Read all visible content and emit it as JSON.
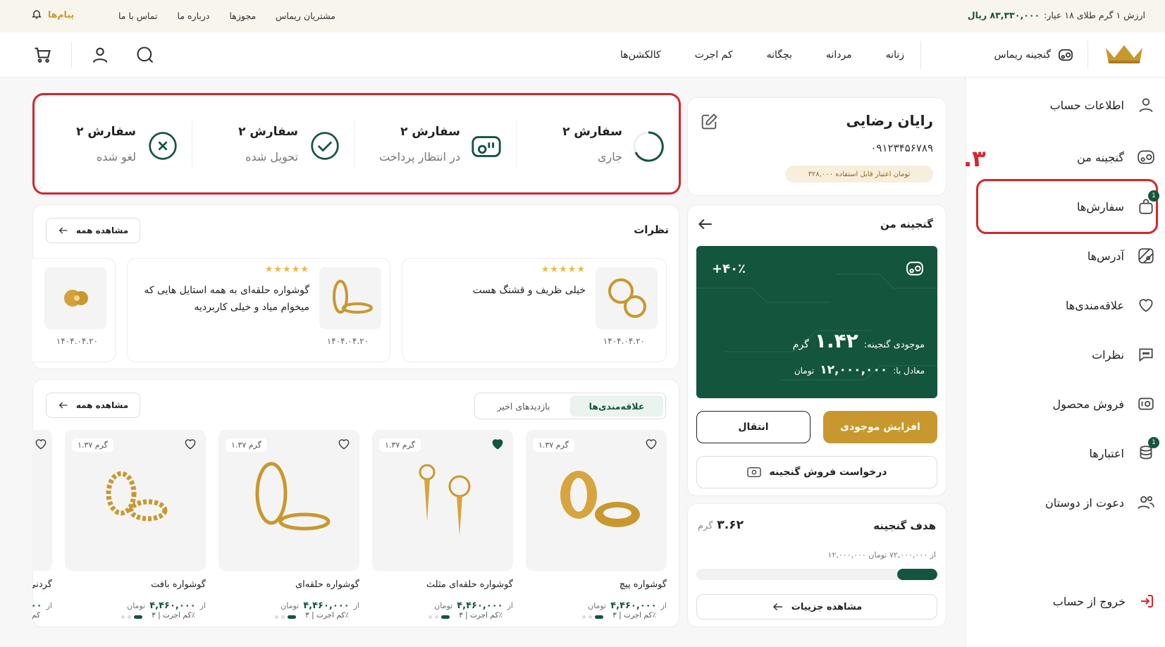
{
  "topbar": {
    "gold_price_label": "ارزش ۱ گرم طلای ۱۸ عیار:",
    "gold_price_value": "۸۳,۳۳۰,۰۰۰ ریال",
    "messages": "پیام‌ها",
    "links": [
      "تماس با ما",
      "درباره ما",
      "مجوزها",
      "مشتریان ریماس"
    ]
  },
  "nav": {
    "items": [
      "گنجینه ریماس",
      "زنانه",
      "مردانه",
      "بچگانه",
      "کم اجرت",
      "کالکشن‌ها"
    ]
  },
  "sidebar": {
    "items": [
      {
        "label": "اطلاعات حساب",
        "icon": "user-icon"
      },
      {
        "label": "گنجینه من",
        "icon": "treasure-icon"
      },
      {
        "label": "سفارش‌ها",
        "icon": "bag-icon",
        "badge": "1"
      },
      {
        "label": "آدرس‌ها",
        "icon": "map-icon"
      },
      {
        "label": "علاقه‌مندی‌ها",
        "icon": "heart-icon"
      },
      {
        "label": "نظرات",
        "icon": "chat-icon"
      },
      {
        "label": "فروش محصول",
        "icon": "sell-icon"
      },
      {
        "label": "اعتبارها",
        "icon": "coins-icon",
        "badge": "1"
      },
      {
        "label": "دعوت از دوستان",
        "icon": "users-icon"
      }
    ],
    "logout": "خروج از حساب",
    "step_marker": ".۳"
  },
  "profile": {
    "name": "رایان رضایی",
    "phone": "۰۹۱۲۳۴۵۶۷۸۹",
    "credit": "۳۲۸,۰۰۰ تومان اعتبار قابل استفاده"
  },
  "orders": [
    {
      "count": "۲ سفارش",
      "status": "جاری",
      "icon": "progress-icon"
    },
    {
      "count": "۲ سفارش",
      "status": "در انتظار پرداخت",
      "icon": "payment-icon"
    },
    {
      "count": "۲ سفارش",
      "status": "تحویل شده",
      "icon": "check-circle-icon"
    },
    {
      "count": "۲ سفارش",
      "status": "لغو شده",
      "icon": "x-circle-icon"
    }
  ],
  "treasure": {
    "title": "گنجینه من",
    "percent": "+۴۰٪",
    "balance_label": "موجودی گنجینه:",
    "balance_value": "۱.۴۲",
    "balance_unit": "گرم",
    "equiv_label": "معادل با:",
    "equiv_value": "۱۲,۰۰۰,۰۰۰",
    "equiv_unit": "تومان",
    "increase_button": "افزایش موجودی",
    "transfer_button": "انتقال",
    "sell_request_button": "درخواست فروش گنجینه"
  },
  "goal": {
    "title": "هدف گنجینه",
    "grams": "۳.۶۲",
    "grams_unit": "گرم",
    "progress_text": "۱۲,۰۰۰,۰۰۰ از ۷۲,۰۰۰,۰۰۰ تومان",
    "progress": 0.166,
    "details_button": "مشاهده جزییات"
  },
  "reviews": {
    "title": "نظرات",
    "view_all": "مشاهده همه",
    "items": [
      {
        "text": "خیلی ظریف و قشنگ هست",
        "date": "۱۴۰۴.۰۴.۲۰",
        "stars": "★★★★★"
      },
      {
        "text": "گوشواره حلقه‌ای به همه استایل هایی که میخوام میاد و خیلی کاربردیه",
        "date": "۱۴۰۴.۰۴.۲۰",
        "stars": "★★★★★"
      },
      {
        "text": "",
        "date": "۱۴۰۴.۰۴.۲۰",
        "stars": ""
      }
    ]
  },
  "products_section": {
    "tab_active": "علاقه‌مندی‌ها",
    "tab_other": "بازدیدهای اخیر",
    "view_all": "مشاهده همه",
    "items": [
      {
        "name": "گوشواره پیچ",
        "weight": "۱.۳۷ گرم",
        "wage": "کم اجرت | ۳٪",
        "price_prefix": "از",
        "price": "۴,۴۶۰,۰۰۰",
        "unit": "تومان",
        "liked": false
      },
      {
        "name": "گوشواره حلقه‌ای مثلث",
        "weight": "۱.۳۷ گرم",
        "wage": "کم اجرت | ۳٪",
        "price_prefix": "از",
        "price": "۴,۴۶۰,۰۰۰",
        "unit": "تومان",
        "liked": true
      },
      {
        "name": "گوشواره حلقه‌ای",
        "weight": "۱.۳۷ گرم",
        "wage": "کم اجرت | ۳٪",
        "price_prefix": "از",
        "price": "۴,۴۶۰,۰۰۰",
        "unit": "تومان",
        "liked": false
      },
      {
        "name": "گوشواره بافت",
        "weight": "۱.۳۷ گرم",
        "wage": "کم اجرت | ۳٪",
        "price_prefix": "از",
        "price": "۴,۴۶۰,۰۰۰",
        "unit": "تومان",
        "liked": false
      },
      {
        "name": "گردنی",
        "weight": "",
        "wage": "کم",
        "price_prefix": "از",
        "price": "۰۰",
        "unit": "",
        "liked": false
      }
    ]
  },
  "colors": {
    "brand_green": "#14553d",
    "gold": "#c8982f",
    "highlight_red": "#d6262a"
  }
}
